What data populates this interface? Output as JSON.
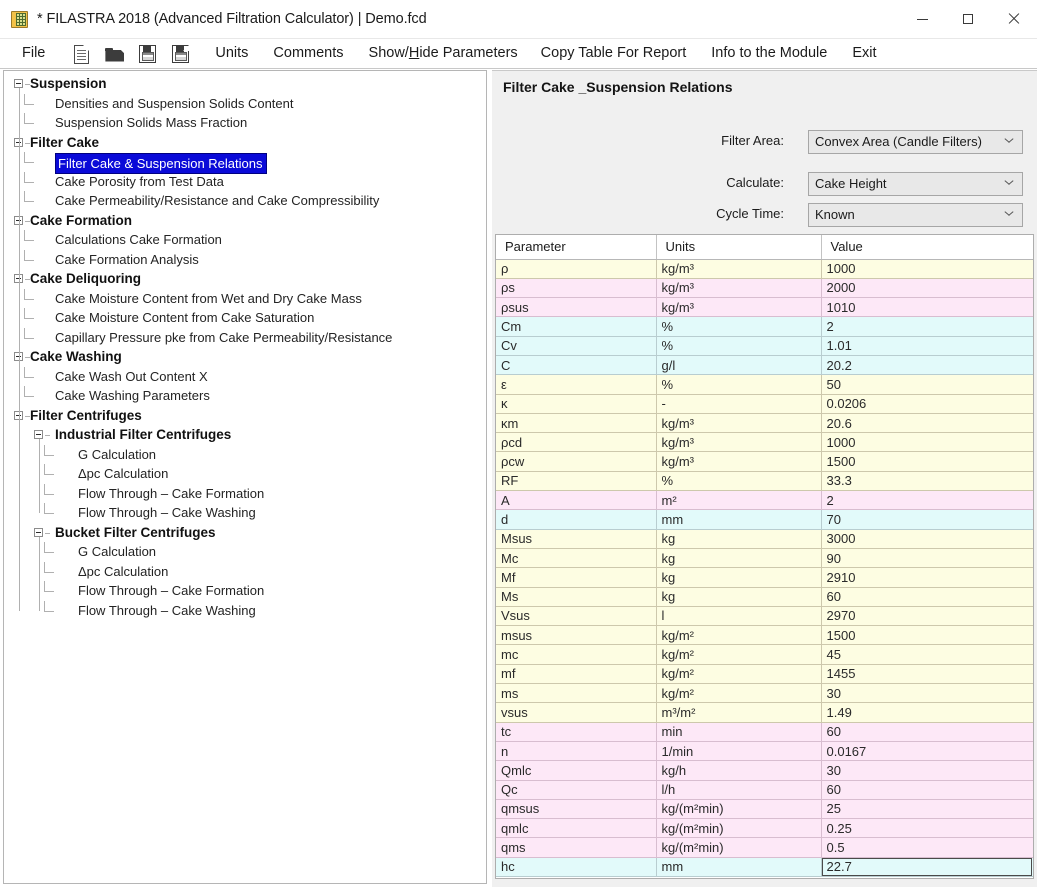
{
  "window": {
    "title": "* FILASTRA 2018 (Advanced Filtration Calculator) | Demo.fcd",
    "icon": "app-icon",
    "minimize": "minimize",
    "maximize": "maximize",
    "close": "close"
  },
  "menubar": {
    "items": [
      {
        "label": "File",
        "type": "menu"
      },
      {
        "label": "",
        "type": "icon",
        "icon": "new-document-icon"
      },
      {
        "label": "",
        "type": "icon",
        "icon": "open-folder-icon"
      },
      {
        "label": "",
        "type": "icon",
        "icon": "save-icon"
      },
      {
        "label": "",
        "type": "icon",
        "icon": "save-as-icon"
      },
      {
        "label": "Units",
        "type": "menu"
      },
      {
        "label": "Comments",
        "type": "menu"
      },
      {
        "label": "Show/Hide Parameters",
        "type": "menu",
        "accel": "H"
      },
      {
        "label": "Copy Table For Report",
        "type": "menu"
      },
      {
        "label": "Info to the Module",
        "type": "menu"
      },
      {
        "label": "Exit",
        "type": "menu"
      }
    ]
  },
  "tree": {
    "selected": "Filter Cake & Suspension Relations",
    "nodes": [
      {
        "label": "Suspension",
        "level": 0,
        "bold": true,
        "expander": true
      },
      {
        "label": "Densities and Suspension Solids Content",
        "level": 1,
        "bold": false,
        "expander": false
      },
      {
        "label": "Suspension Solids Mass Fraction",
        "level": 1,
        "bold": false,
        "expander": false
      },
      {
        "label": "Filter Cake",
        "level": 0,
        "bold": true,
        "expander": true
      },
      {
        "label": "Filter Cake & Suspension Relations",
        "level": 1,
        "bold": false,
        "expander": false,
        "selected": true
      },
      {
        "label": "Cake Porosity from Test Data",
        "level": 1,
        "bold": false,
        "expander": false
      },
      {
        "label": "Cake Permeability/Resistance and Cake Compressibility",
        "level": 1,
        "bold": false,
        "expander": false
      },
      {
        "label": "Cake Formation",
        "level": 0,
        "bold": true,
        "expander": true
      },
      {
        "label": "Calculations Cake Formation",
        "level": 1,
        "bold": false,
        "expander": false
      },
      {
        "label": "Cake Formation Analysis",
        "level": 1,
        "bold": false,
        "expander": false
      },
      {
        "label": "Cake Deliquoring",
        "level": 0,
        "bold": true,
        "expander": true
      },
      {
        "label": "Cake Moisture Content from Wet and Dry Cake Mass",
        "level": 1,
        "bold": false,
        "expander": false
      },
      {
        "label": "Cake Moisture Content from Cake Saturation",
        "level": 1,
        "bold": false,
        "expander": false
      },
      {
        "label": "Capillary Pressure pke from Cake Permeability/Resistance",
        "level": 1,
        "bold": false,
        "expander": false
      },
      {
        "label": "Cake Washing",
        "level": 0,
        "bold": true,
        "expander": true
      },
      {
        "label": "Cake Wash Out Content X",
        "level": 1,
        "bold": false,
        "expander": false
      },
      {
        "label": "Cake Washing Parameters",
        "level": 1,
        "bold": false,
        "expander": false
      },
      {
        "label": "Filter Centrifuges",
        "level": 0,
        "bold": true,
        "expander": true
      },
      {
        "label": "Industrial Filter Centrifuges",
        "level": 1,
        "bold": true,
        "expander": true
      },
      {
        "label": "G Calculation",
        "level": 2,
        "bold": false,
        "expander": false
      },
      {
        "label": "Δpc Calculation",
        "level": 2,
        "bold": false,
        "expander": false
      },
      {
        "label": "Flow Through – Cake Formation",
        "level": 2,
        "bold": false,
        "expander": false
      },
      {
        "label": "Flow Through – Cake Washing",
        "level": 2,
        "bold": false,
        "expander": false
      },
      {
        "label": "Bucket Filter Centrifuges",
        "level": 1,
        "bold": true,
        "expander": true
      },
      {
        "label": "G Calculation",
        "level": 2,
        "bold": false,
        "expander": false
      },
      {
        "label": "Δpc Calculation",
        "level": 2,
        "bold": false,
        "expander": false
      },
      {
        "label": "Flow Through – Cake Formation",
        "level": 2,
        "bold": false,
        "expander": false
      },
      {
        "label": "Flow Through – Cake Washing",
        "level": 2,
        "bold": false,
        "expander": false
      }
    ]
  },
  "panel": {
    "title": "Filter Cake _Suspension Relations",
    "fields": [
      {
        "label": "Filter Area:",
        "value": "Convex Area (Candle Filters)"
      },
      {
        "label": "Calculate:",
        "value": "Cake Height"
      },
      {
        "label": "Cycle Time:",
        "value": "Known"
      }
    ]
  },
  "table": {
    "headers": [
      "Parameter",
      "Units",
      "Value"
    ],
    "rows": [
      {
        "parameter": "ρ",
        "units": "kg/m³",
        "value": "1000",
        "color": "yellow",
        "input": true
      },
      {
        "parameter": "ρs",
        "units": "kg/m³",
        "value": "2000",
        "color": "pink",
        "input": true
      },
      {
        "parameter": "ρsus",
        "units": "kg/m³",
        "value": "1010",
        "color": "pink",
        "input": false
      },
      {
        "parameter": "Cm",
        "units": "%",
        "value": "2",
        "color": "cyan",
        "input": true
      },
      {
        "parameter": "Cv",
        "units": "%",
        "value": "1.01",
        "color": "cyan",
        "input": false
      },
      {
        "parameter": "C",
        "units": "g/l",
        "value": "20.2",
        "color": "cyan",
        "input": false
      },
      {
        "parameter": "ε",
        "units": "%",
        "value": "50",
        "color": "yellow",
        "input": true
      },
      {
        "parameter": "κ",
        "units": "-",
        "value": "0.0206",
        "color": "yellow",
        "input": false
      },
      {
        "parameter": "κm",
        "units": "kg/m³",
        "value": "20.6",
        "color": "yellow",
        "input": false
      },
      {
        "parameter": "ρcd",
        "units": "kg/m³",
        "value": "1000",
        "color": "yellow",
        "input": false
      },
      {
        "parameter": "ρcw",
        "units": "kg/m³",
        "value": "1500",
        "color": "yellow",
        "input": false
      },
      {
        "parameter": "RF",
        "units": "%",
        "value": "33.3",
        "color": "yellow",
        "input": false
      },
      {
        "parameter": "A",
        "units": "m²",
        "value": "2",
        "color": "pink",
        "input": true
      },
      {
        "parameter": "d",
        "units": "mm",
        "value": "70",
        "color": "cyan",
        "input": true
      },
      {
        "parameter": "Msus",
        "units": "kg",
        "value": "3000",
        "color": "yellow",
        "input": true
      },
      {
        "parameter": "Mc",
        "units": "kg",
        "value": "90",
        "color": "yellow",
        "input": false
      },
      {
        "parameter": "Mf",
        "units": "kg",
        "value": "2910",
        "color": "yellow",
        "input": false
      },
      {
        "parameter": "Ms",
        "units": "kg",
        "value": "60",
        "color": "yellow",
        "input": false
      },
      {
        "parameter": "Vsus",
        "units": "l",
        "value": "2970",
        "color": "yellow",
        "input": false
      },
      {
        "parameter": "msus",
        "units": "kg/m²",
        "value": "1500",
        "color": "yellow",
        "input": false
      },
      {
        "parameter": "mc",
        "units": "kg/m²",
        "value": "45",
        "color": "yellow",
        "input": false
      },
      {
        "parameter": "mf",
        "units": "kg/m²",
        "value": "1455",
        "color": "yellow",
        "input": false
      },
      {
        "parameter": "ms",
        "units": "kg/m²",
        "value": "30",
        "color": "yellow",
        "input": false
      },
      {
        "parameter": "vsus",
        "units": "m³/m²",
        "value": "1.49",
        "color": "yellow",
        "input": false
      },
      {
        "parameter": "tc",
        "units": "min",
        "value": "60",
        "color": "pink",
        "input": true
      },
      {
        "parameter": "n",
        "units": "1/min",
        "value": "0.0167",
        "color": "pink",
        "input": false
      },
      {
        "parameter": "Qmlc",
        "units": "kg/h",
        "value": "30",
        "color": "pink",
        "input": false
      },
      {
        "parameter": "Qc",
        "units": "l/h",
        "value": "60",
        "color": "pink",
        "input": false
      },
      {
        "parameter": "qmsus",
        "units": "kg/(m²min)",
        "value": "25",
        "color": "pink",
        "input": false
      },
      {
        "parameter": "qmlc",
        "units": "kg/(m²min)",
        "value": "0.25",
        "color": "pink",
        "input": false
      },
      {
        "parameter": "qms",
        "units": "kg/(m²min)",
        "value": "0.5",
        "color": "pink",
        "input": false
      },
      {
        "parameter": "hc",
        "units": "mm",
        "value": "22.7",
        "color": "cyan",
        "input": false,
        "focused": true
      }
    ]
  },
  "colors": {
    "selection_blue": "#0a0ad8",
    "input_value_blue": "#3636e8",
    "row_yellow": "#fdfde2",
    "row_pink": "#fde8f7",
    "row_cyan": "#e2fafa",
    "panel_gray": "#f0f0f0"
  }
}
